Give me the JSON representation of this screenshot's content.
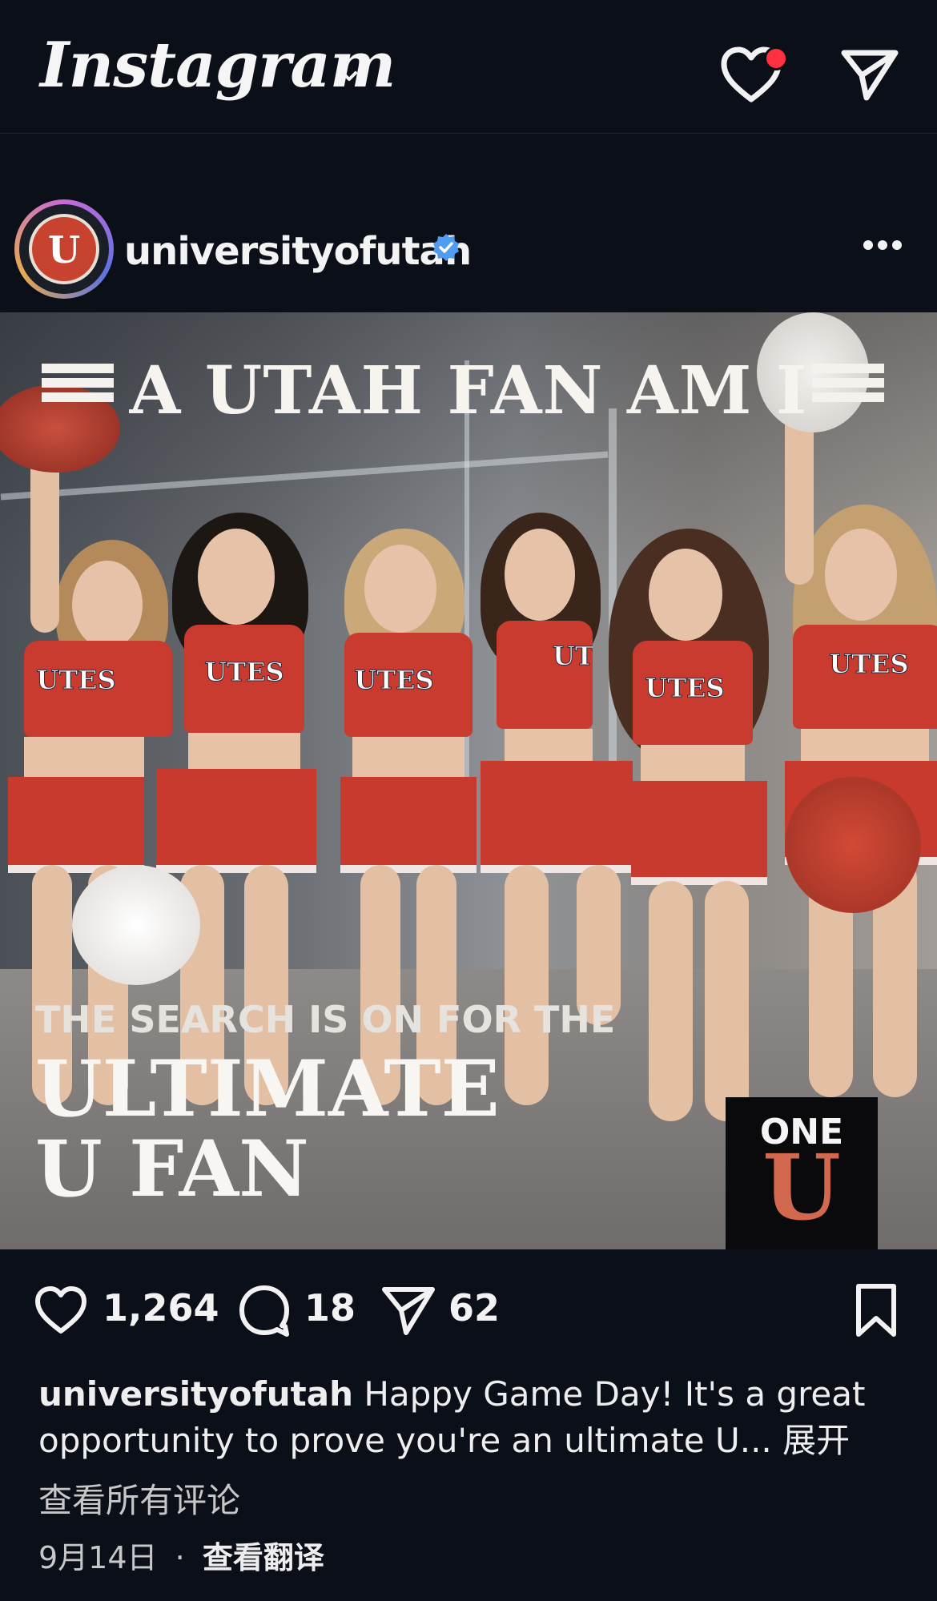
{
  "app": {
    "logo": "Instagram"
  },
  "post": {
    "username": "universityofutah",
    "avatar_letter": "U",
    "image": {
      "headline": "A UTAH FAN AM I",
      "search_line": "THE SEARCH IS ON FOR THE",
      "title_line1": "ULTIMATE",
      "title_line2": "U FAN",
      "badge_top": "ONE",
      "badge_letter": "U",
      "jersey_text": "UTES"
    },
    "likes": "1,264",
    "comments": "18",
    "shares": "62",
    "caption_user": "universityofutah",
    "caption_text": "Happy Game Day! It's a great opportunity to prove you're an ultimate U...",
    "expand": "展开",
    "view_comments": "查看所有评论",
    "date": "9月14日",
    "separator": "·",
    "translate": "查看翻译"
  },
  "colors": {
    "background": "#0b0f17",
    "notification_dot": "#ff3040",
    "utah_red": "#c93a2f",
    "verified_blue": "#4f9cf0"
  }
}
